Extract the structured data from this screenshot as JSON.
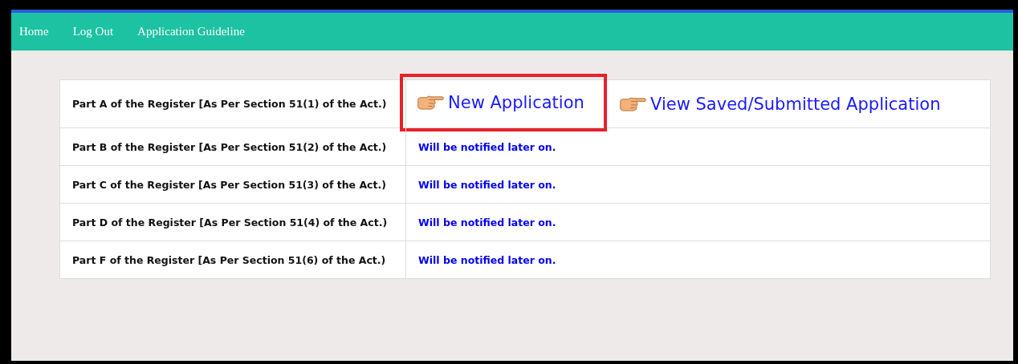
{
  "nav": [
    {
      "label": "Home"
    },
    {
      "label": "Log Out"
    },
    {
      "label": "Application Guideline"
    }
  ],
  "rows": [
    {
      "kind": "links",
      "part": "Part A of the Register [As Per Section 51(1) of the Act.)",
      "links": [
        {
          "label": "New Application",
          "highlighted": true
        },
        {
          "label": "View Saved/Submitted Application",
          "highlighted": false
        }
      ]
    },
    {
      "kind": "notice",
      "part": "Part B of the Register [As Per Section 51(2) of the Act.)",
      "notice": "Will be notified later on."
    },
    {
      "kind": "notice",
      "part": "Part C of the Register [As Per Section 51(3) of the Act.)",
      "notice": "Will be notified later on."
    },
    {
      "kind": "notice",
      "part": "Part D of the Register [As Per Section 51(4) of the Act.)",
      "notice": "Will be notified later on."
    },
    {
      "kind": "notice",
      "part": "Part F of the Register [As Per Section 51(6) of the Act.)",
      "notice": "Will be notified later on."
    }
  ]
}
